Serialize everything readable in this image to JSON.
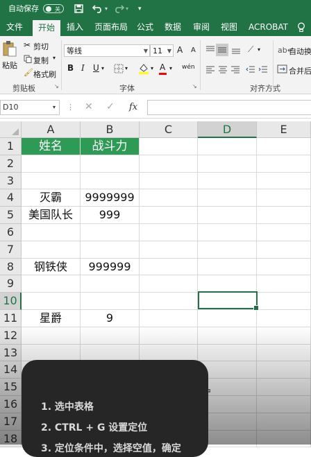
{
  "titlebar": {
    "autosave_label": "自动保存",
    "autosave_state": "关"
  },
  "menu": {
    "tabs": [
      {
        "label": "文件"
      },
      {
        "label": "开始",
        "active": true
      },
      {
        "label": "插入"
      },
      {
        "label": "页面布局"
      },
      {
        "label": "公式"
      },
      {
        "label": "数据"
      },
      {
        "label": "审阅"
      },
      {
        "label": "视图"
      },
      {
        "label": "ACROBAT"
      }
    ]
  },
  "ribbon": {
    "clipboard": {
      "paste_label": "粘贴",
      "cut_label": "剪切",
      "copy_label": "复制",
      "format_painter_label": "格式刷",
      "group_label": "剪贴板"
    },
    "font": {
      "font_name": "等线",
      "font_size": "11",
      "bold": "B",
      "italic": "I",
      "underline": "U",
      "grow": "A",
      "shrink": "A",
      "font_color": "A",
      "phonetic": "wén",
      "group_label": "字体"
    },
    "alignment": {
      "wrap_label": "自动换",
      "merge_label": "合并后",
      "group_label": "对齐方式"
    }
  },
  "formula_bar": {
    "name_box": "D10",
    "fx_label": "fx",
    "value": ""
  },
  "sheet": {
    "columns": [
      "A",
      "B",
      "C",
      "D",
      "E"
    ],
    "rows": [
      "1",
      "2",
      "3",
      "4",
      "5",
      "6",
      "7",
      "8",
      "9",
      "10",
      "11",
      "12",
      "13",
      "14",
      "15",
      "16",
      "17",
      "18"
    ],
    "cells": {
      "A1": "姓名",
      "B1": "战斗力",
      "A4": "灭霸",
      "B4": "9999999",
      "A5": "美国队长",
      "B5": "999",
      "A8": "钢铁侠",
      "B8": "999999",
      "A11": "星爵",
      "B11": "9"
    },
    "header_fill": "#2d9a56",
    "selected_cell": "D10"
  },
  "tips": [
    "1. 选中表格",
    "2. CTRL + G 设置定位",
    "3. 定位条件中，选择空值，确定"
  ],
  "colors": {
    "excel_green": "#217346",
    "ribbon_bg": "#f3f3f3"
  }
}
